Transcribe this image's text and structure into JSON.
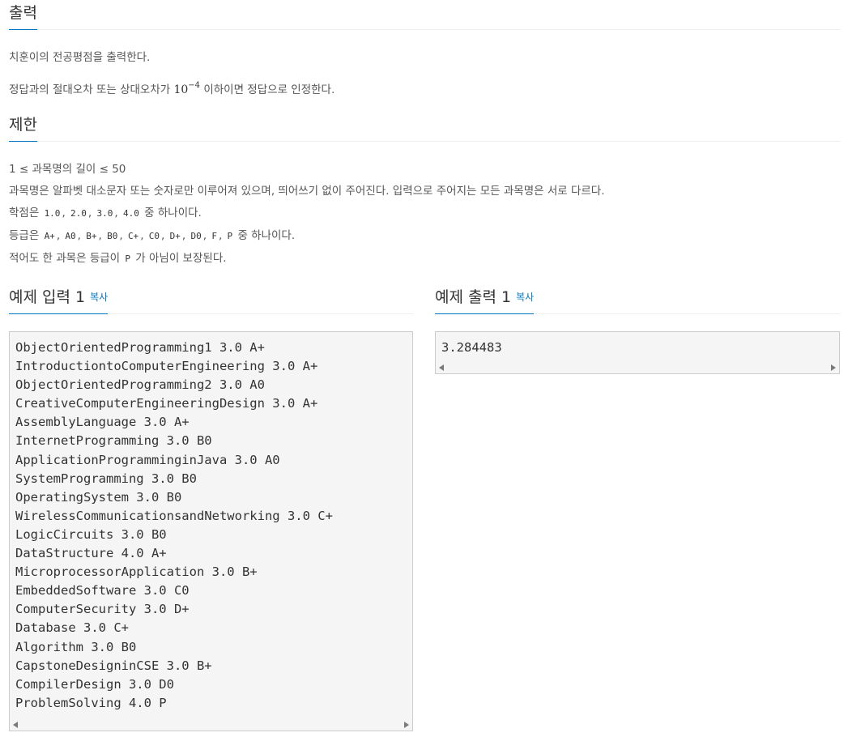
{
  "output_section": {
    "title": "출력",
    "line1": "치훈이의 전공평점을 출력한다.",
    "line2_before": "정답과의 절대오차 또는 상대오차가 ",
    "line2_math_base": "10",
    "line2_math_exp": "−4",
    "line2_after": " 이하이면 정답으로 인정한다."
  },
  "limits_section": {
    "title": "제한",
    "items": [
      "1 ≤ 과목명의 길이 ≤ 50",
      "과목명은 알파벳 대소문자 또는 숫자로만 이루어져 있으며, 띄어쓰기 없이 주어진다. 입력으로 주어지는 모든 과목명은 서로 다르다.",
      "학점은",
      "중 하나이다.",
      "등급은",
      "중 하나이다.",
      "적어도 한 과목은 등급이",
      "가 아님이 보장된다."
    ],
    "credit_values": [
      "1.0",
      "2.0",
      "3.0",
      "4.0"
    ],
    "grade_values": [
      "A+",
      "A0",
      "B+",
      "B0",
      "C+",
      "C0",
      "D+",
      "D0",
      "F",
      "P"
    ],
    "not_p_value": "P",
    "separator": ","
  },
  "sample_input": {
    "title": "예제 입력 1",
    "copy_label": "복사",
    "lines": [
      "ObjectOrientedProgramming1 3.0 A+",
      "IntroductiontoComputerEngineering 3.0 A+",
      "ObjectOrientedProgramming2 3.0 A0",
      "CreativeComputerEngineeringDesign 3.0 A+",
      "AssemblyLanguage 3.0 A+",
      "InternetProgramming 3.0 B0",
      "ApplicationProgramminginJava 3.0 A0",
      "SystemProgramming 3.0 B0",
      "OperatingSystem 3.0 B0",
      "WirelessCommunicationsandNetworking 3.0 C+",
      "LogicCircuits 3.0 B0",
      "DataStructure 4.0 A+",
      "MicroprocessorApplication 3.0 B+",
      "EmbeddedSoftware 3.0 C0",
      "ComputerSecurity 3.0 D+",
      "Database 3.0 C+",
      "Algorithm 3.0 B0",
      "CapstoneDesigninCSE 3.0 B+",
      "CompilerDesign 3.0 D0",
      "ProblemSolving 4.0 P"
    ]
  },
  "sample_output": {
    "title": "예제 출력 1",
    "copy_label": "복사",
    "lines": [
      "3.284483"
    ]
  }
}
